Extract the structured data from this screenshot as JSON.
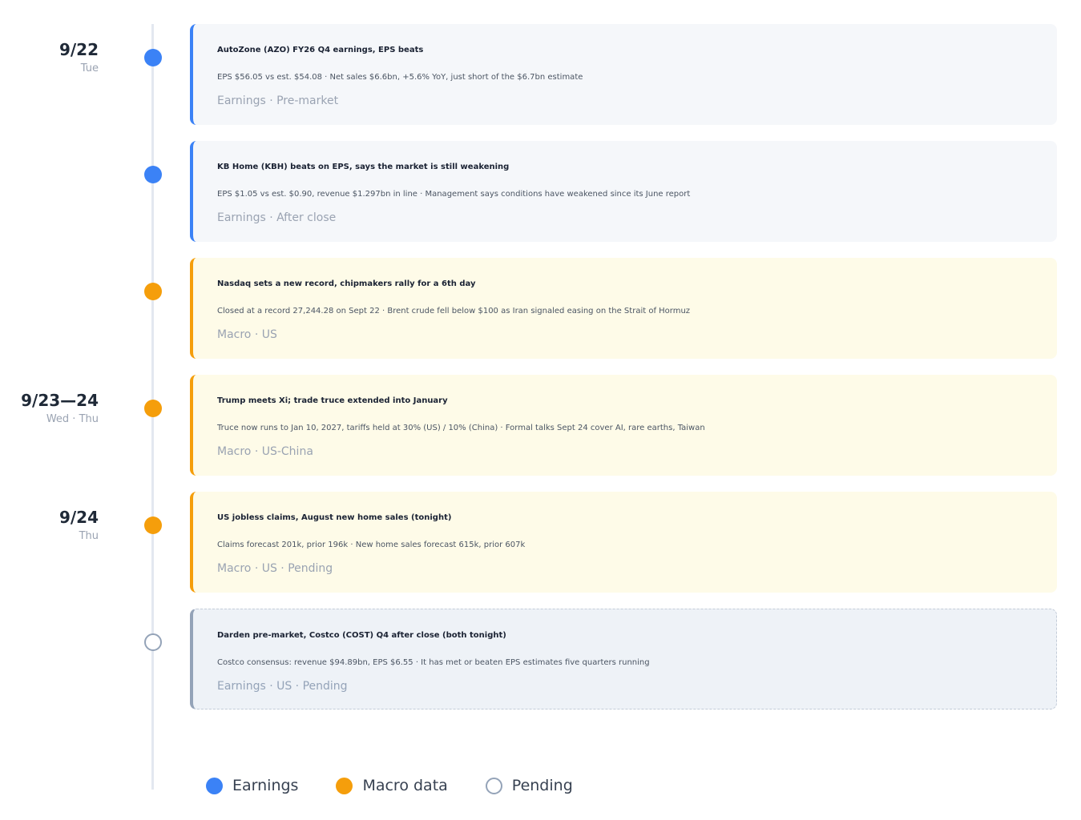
{
  "dates": [
    {
      "main": "9/22",
      "sub": "Tue"
    },
    {
      "main": "9/23—24",
      "sub": "Wed · Thu"
    },
    {
      "main": "9/24",
      "sub": "Thu"
    }
  ],
  "events": [
    {
      "kind": "earnings",
      "title": "AutoZone (AZO) FY26 Q4 earnings, EPS beats",
      "desc": "EPS $56.05 vs est. $54.08 · Net sales $6.6bn, +5.6% YoY, just short of the $6.7bn estimate",
      "tags": "Earnings · Pre-market"
    },
    {
      "kind": "earnings",
      "title": "KB Home (KBH) beats on EPS, says the market is still weakening",
      "desc": "EPS $1.05 vs est. $0.90, revenue $1.297bn in line · Management says conditions have weakened since its June report",
      "tags": "Earnings · After close"
    },
    {
      "kind": "macro",
      "title": "Nasdaq sets a new record, chipmakers rally for a 6th day",
      "desc": "Closed at a record 27,244.28 on Sept 22 · Brent crude fell below $100 as Iran signaled easing on the Strait of Hormuz",
      "tags": "Macro · US"
    },
    {
      "kind": "macro",
      "title": "Trump meets Xi; trade truce extended into January",
      "desc": "Truce now runs to Jan 10, 2027, tariffs held at 30% (US) / 10% (China) · Formal talks Sept 24 cover AI, rare earths, Taiwan",
      "tags": "Macro · US-China"
    },
    {
      "kind": "macro",
      "title": "US jobless claims, August new home sales (tonight)",
      "desc": "Claims forecast 201k, prior 196k · New home sales forecast 615k, prior 607k",
      "tags": "Macro · US · Pending"
    },
    {
      "kind": "pending",
      "title": "Darden pre-market, Costco (COST) Q4 after close (both tonight)",
      "desc": "Costco consensus: revenue $94.89bn, EPS $6.55 · It has met or beaten EPS estimates five quarters running",
      "tags": "Earnings · US · Pending"
    }
  ],
  "legend": {
    "earnings": "Earnings",
    "macro": "Macro data",
    "pending": "Pending"
  },
  "colors": {
    "earnings": "#3b82f6",
    "macro": "#f59e0b",
    "pending": "#94a3b8"
  }
}
